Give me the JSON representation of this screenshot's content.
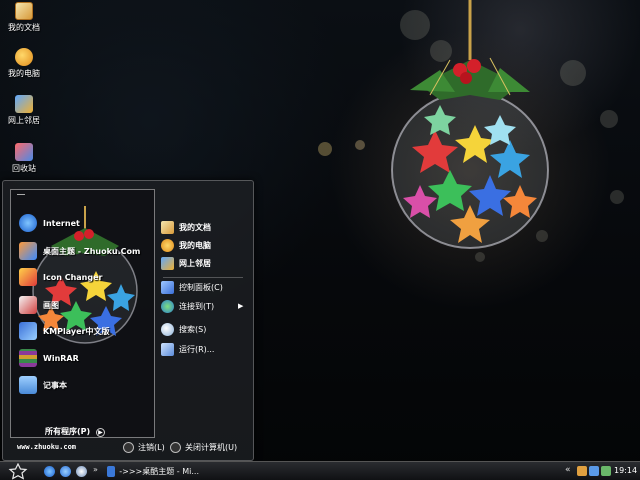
{
  "desktop": {
    "icons": [
      {
        "label": "我的文档",
        "icon": "my-documents-icon"
      },
      {
        "label": "我的电脑",
        "icon": "my-computer-icon"
      },
      {
        "label": "网上邻居",
        "icon": "network-icon"
      },
      {
        "label": "回收站",
        "icon": "recycle-bin-icon"
      }
    ]
  },
  "start_menu": {
    "pinned": [
      {
        "label": "Internet",
        "icon": "internet-explorer-icon"
      },
      {
        "label": "桌面主题 - Zhuoku.Com",
        "icon": "theme-icon"
      },
      {
        "label": "Icon Changer",
        "icon": "icon-changer-icon"
      },
      {
        "label": "画图",
        "icon": "paint-icon"
      },
      {
        "label": "KMPlayer中文版",
        "icon": "kmplayer-icon"
      },
      {
        "label": "WinRAR",
        "icon": "winrar-icon"
      },
      {
        "label": "记事本",
        "icon": "notepad-icon"
      }
    ],
    "all_programs": "所有程序(P)",
    "right_items": [
      {
        "label": "我的文档",
        "icon": "my-documents-icon"
      },
      {
        "label": "我的电脑",
        "icon": "my-computer-icon"
      },
      {
        "label": "网上邻居",
        "icon": "network-icon"
      },
      {
        "label": "控制面板(C)",
        "icon": "control-panel-icon"
      },
      {
        "label": "连接到(T)",
        "icon": "connect-to-icon"
      },
      {
        "label": "搜索(S)",
        "icon": "search-icon"
      },
      {
        "label": "运行(R)...",
        "icon": "run-icon"
      }
    ],
    "footer_url": "www.zhuoku.com",
    "logoff": "注销(L)",
    "shutdown": "关闭计算机(U)"
  },
  "taskbar": {
    "arrow": "»",
    "task_label": "->>>桌酷主题 - Mi...",
    "tray_chevron": "«",
    "clock": "19:14"
  },
  "colors": {
    "taskbar_top": "#2a2c30",
    "menu_bg": "#1e2024"
  }
}
